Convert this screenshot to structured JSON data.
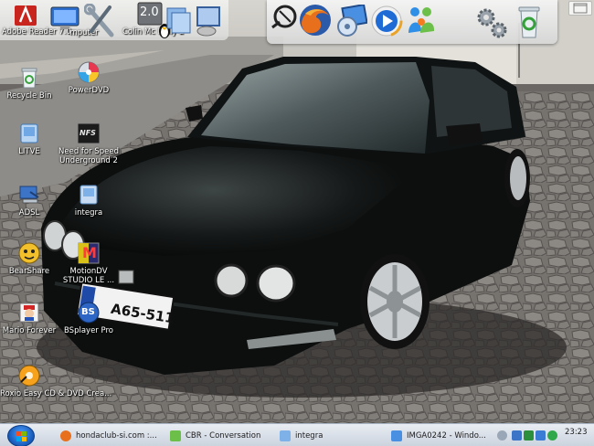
{
  "dock": {
    "left_items": [
      {
        "name": "adobe-reader",
        "label": "Adobe Reader 7.0"
      },
      {
        "name": "my-computer",
        "label": "mputer"
      },
      {
        "name": "colin-mcrae",
        "label": "Colin Mc Rally 2"
      }
    ],
    "colin_badge": "2.0",
    "apps": [
      "tools",
      "firefox",
      "media",
      "realplayer",
      "messenger",
      "settings",
      "recycle"
    ]
  },
  "desktop": {
    "icons": [
      {
        "id": "recycle-bin",
        "label": "Recycle Bin"
      },
      {
        "id": "powerdvd",
        "label": "PowerDVD"
      },
      {
        "id": "litve",
        "label": "LITVE"
      },
      {
        "id": "need-for-speed",
        "label": "Need for Speed Underground 2"
      },
      {
        "id": "adsl",
        "label": "ADSL"
      },
      {
        "id": "integra",
        "label": "integra"
      },
      {
        "id": "bearshare",
        "label": "BearShare"
      },
      {
        "id": "motiondv",
        "label": "MotionDV STUDIO LE ..."
      },
      {
        "id": "mario-forever",
        "label": "Mario Forever"
      },
      {
        "id": "bsplayer",
        "label": "BSplayer Pro"
      },
      {
        "id": "roxio",
        "label": "Roxio Easy CD & DVD Crea..."
      }
    ],
    "nfs_badge": "NFS",
    "bs_badge": "BS",
    "motion_badge": "M"
  },
  "wallpaper": {
    "license_plate": "A65-511"
  },
  "taskbar": {
    "tasks": [
      {
        "label": "hondaclub-si.com :..."
      },
      {
        "label": "CBR - Conversation"
      },
      {
        "label": "integra"
      },
      {
        "label": "IMGA0242 - Windo..."
      }
    ],
    "clock": "23:23"
  },
  "colors": {
    "taskbar": "#cbd3de",
    "start_orb": "#1658b8",
    "car_body": "#0d0f0f"
  }
}
